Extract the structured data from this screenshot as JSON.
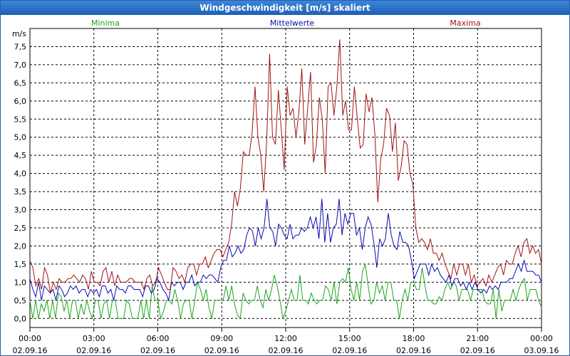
{
  "window": {
    "title": "Windgeschwindigkeit [m/s] skaliert"
  },
  "chart_data": {
    "type": "line",
    "title": "Windgeschwindigkeit [m/s] skaliert",
    "ylabel": "m/s",
    "ylim": [
      -0.25,
      8.0
    ],
    "y_ticks": [
      "0,0",
      "0,5",
      "1,0",
      "1,5",
      "2,0",
      "2,5",
      "3,0",
      "3,5",
      "4,0",
      "4,5",
      "5,0",
      "5,5",
      "6,0",
      "6,5",
      "7,0",
      "7,5"
    ],
    "x_ticks": [
      {
        "time": "00:00",
        "date": "02.09.16"
      },
      {
        "time": "03:00",
        "date": "02.09.16"
      },
      {
        "time": "06:00",
        "date": "02.09.16"
      },
      {
        "time": "09:00",
        "date": "02.09.16"
      },
      {
        "time": "12:00",
        "date": "02.09.16"
      },
      {
        "time": "15:00",
        "date": "02.09.16"
      },
      {
        "time": "18:00",
        "date": "02.09.16"
      },
      {
        "time": "21:00",
        "date": "02.09.16"
      },
      {
        "time": "00:00",
        "date": "03.09.16"
      }
    ],
    "grid": true,
    "legend_position": "top",
    "series": [
      {
        "name": "Minima",
        "color": "#1aa61a",
        "values": [
          0.5,
          0.0,
          0.5,
          0.0,
          0.4,
          0.2,
          0.5,
          0.0,
          0.5,
          0.0,
          0.7,
          0.6,
          0.2,
          0.5,
          0.0,
          0.5,
          0.5,
          0.0,
          0.4,
          0.1,
          0.5,
          0.2,
          0.0,
          0.5,
          0.5,
          0.0,
          0.4,
          0.5,
          0.0,
          0.5,
          0.5,
          0.0,
          0.0,
          0.0,
          0.5,
          0.4,
          0.0,
          0.0,
          0.0,
          0.5,
          0.0,
          0.5,
          0.0,
          0.9,
          0.5,
          0.5,
          0.0,
          0.2,
          0.5,
          0.5,
          0.4,
          0.8,
          0.5,
          0.0,
          0.4,
          0.5,
          0.5,
          0.0,
          0.5,
          1.0,
          0.8,
          0.5,
          0.8,
          0.3,
          0.0,
          0.5,
          0.5,
          0.5,
          0.5,
          0.9,
          0.5,
          0.9,
          0.4,
          0.1,
          0.0,
          0.7,
          0.5,
          0.4,
          0.5,
          0.5,
          0.9,
          0.5,
          0.3,
          0.8,
          0.5,
          0.8,
          1.2,
          0.9,
          0.5,
          0.0,
          0.2,
          0.5,
          0.8,
          0.5,
          0.5,
          1.2,
          0.5,
          0.5,
          0.4,
          0.7,
          0.5,
          0.4,
          0.5,
          0.5,
          0.9,
          0.8,
          0.5,
          1.0,
          0.4,
          1.0,
          1.1,
          1.0,
          1.4,
          0.8,
          0.5,
          1.0,
          0.5,
          1.3,
          1.5,
          0.9,
          0.4,
          0.5,
          1.0,
          0.7,
          0.9,
          0.5,
          1.0,
          1.0,
          0.5,
          0.5,
          0.0,
          0.5,
          0.8,
          0.5,
          1.0,
          1.0,
          0.8,
          0.8,
          1.4,
          0.9,
          0.5,
          0.5,
          0.4,
          0.4,
          0.6,
          0.5,
          0.8,
          1.0,
          0.8,
          1.0,
          0.9,
          0.5,
          0.8,
          0.8,
          0.8,
          0.5,
          0.8,
          0.8,
          0.8,
          0.8,
          0.5,
          0.4,
          0.4,
          0.8,
          0.0,
          0.8,
          0.2,
          0.5,
          0.5,
          0.5,
          0.8,
          0.5,
          0.8,
          1.0,
          1.1,
          0.5,
          0.8,
          0.8,
          0.8,
          0.5,
          0.3
        ]
      },
      {
        "name": "Mittelwerte",
        "color": "#0a0ab4",
        "values": [
          1.1,
          0.8,
          0.6,
          1.0,
          0.5,
          0.9,
          0.8,
          0.7,
          0.8,
          0.5,
          0.9,
          0.8,
          0.6,
          0.7,
          0.9,
          0.8,
          0.9,
          0.7,
          0.8,
          0.8,
          0.6,
          0.8,
          0.7,
          0.8,
          0.6,
          0.9,
          0.9,
          0.7,
          0.8,
          0.5,
          0.9,
          0.8,
          0.8,
          0.7,
          0.9,
          0.9,
          0.8,
          0.8,
          0.8,
          0.6,
          0.9,
          0.9,
          0.7,
          0.8,
          1.1,
          1.0,
          0.8,
          0.7,
          0.5,
          1.0,
          0.9,
          1.0,
          1.0,
          0.8,
          1.0,
          1.0,
          1.2,
          0.9,
          1.0,
          1.0,
          1.2,
          1.1,
          1.2,
          1.2,
          1.1,
          1.0,
          1.4,
          1.6,
          1.6,
          2.0,
          1.7,
          1.8,
          2.0,
          1.8,
          1.9,
          2.3,
          2.5,
          2.4,
          2.0,
          2.5,
          2.2,
          2.5,
          3.3,
          2.5,
          2.4,
          2.0,
          2.6,
          2.5,
          2.3,
          2.2,
          2.6,
          2.2,
          2.3,
          2.3,
          2.5,
          2.4,
          2.5,
          2.8,
          2.5,
          2.8,
          2.2,
          3.3,
          2.1,
          2.9,
          2.1,
          2.5,
          2.6,
          3.3,
          2.3,
          2.9,
          2.6,
          2.9,
          2.9,
          2.3,
          2.5,
          1.9,
          2.5,
          2.8,
          2.6,
          2.1,
          1.4,
          2.2,
          2.0,
          2.2,
          2.9,
          2.3,
          2.0,
          1.9,
          2.4,
          2.1,
          2.1,
          2.0,
          1.6,
          1.1,
          1.3,
          1.5,
          1.5,
          1.5,
          1.2,
          1.5,
          1.3,
          1.4,
          1.2,
          1.1,
          1.0,
          1.2,
          0.9,
          1.1,
          1.1,
          0.9,
          1.0,
          0.8,
          1.0,
          0.8,
          1.0,
          0.8,
          0.7,
          0.8,
          0.7,
          0.9,
          0.8,
          0.9,
          0.8,
          1.0,
          1.0,
          1.0,
          1.1,
          1.1,
          1.3,
          1.5,
          1.3,
          1.6,
          1.3,
          1.3,
          1.3,
          1.2,
          1.2,
          1.0
        ]
      },
      {
        "name": "Maxima",
        "color": "#a01414",
        "values": [
          1.6,
          1.4,
          0.9,
          1.1,
          0.8,
          1.4,
          1.2,
          0.7,
          1.0,
          0.8,
          1.1,
          1.0,
          1.0,
          1.1,
          1.1,
          1.2,
          1.1,
          1.0,
          1.2,
          1.1,
          0.8,
          1.3,
          1.0,
          1.0,
          0.9,
          1.3,
          1.4,
          1.0,
          1.3,
          0.9,
          1.2,
          1.0,
          1.0,
          1.0,
          1.1,
          1.1,
          1.0,
          1.0,
          1.0,
          0.8,
          1.1,
          1.2,
          0.9,
          1.0,
          1.4,
          1.2,
          1.0,
          0.8,
          0.8,
          1.4,
          1.3,
          1.1,
          1.2,
          1.0,
          1.4,
          1.5,
          1.5,
          1.2,
          1.5,
          1.5,
          1.7,
          1.4,
          1.6,
          1.8,
          1.9,
          1.9,
          1.7,
          1.9,
          2.1,
          2.6,
          3.5,
          3.1,
          3.6,
          4.6,
          4.5,
          4.5,
          5.1,
          6.4,
          5.0,
          4.5,
          3.5,
          4.9,
          7.3,
          5.0,
          4.8,
          6.3,
          5.2,
          4.1,
          6.4,
          5.6,
          5.8,
          5.0,
          5.7,
          6.9,
          4.8,
          5.8,
          6.8,
          4.3,
          4.8,
          6.1,
          5.5,
          4.0,
          6.4,
          6.5,
          5.6,
          6.4,
          7.7,
          5.6,
          6.0,
          5.2,
          5.2,
          6.4,
          5.5,
          4.7,
          4.8,
          6.2,
          5.7,
          6.1,
          5.1,
          3.2,
          4.4,
          4.8,
          5.8,
          5.6,
          4.6,
          5.4,
          3.8,
          4.2,
          4.9,
          4.8,
          4.0,
          3.7,
          2.5,
          2.1,
          2.2,
          2.1,
          1.9,
          2.2,
          1.8,
          1.8,
          1.6,
          1.8,
          1.5,
          1.3,
          1.1,
          1.5,
          1.2,
          1.5,
          1.5,
          1.2,
          1.5,
          1.0,
          1.2,
          0.9,
          1.0,
          1.1,
          0.9,
          1.2,
          1.0,
          1.2,
          1.4,
          1.5,
          1.2,
          1.6,
          1.5,
          1.5,
          1.8,
          2.0,
          1.7,
          2.1,
          2.2,
          1.8,
          2.0,
          1.8,
          1.9,
          1.5
        ]
      }
    ]
  }
}
